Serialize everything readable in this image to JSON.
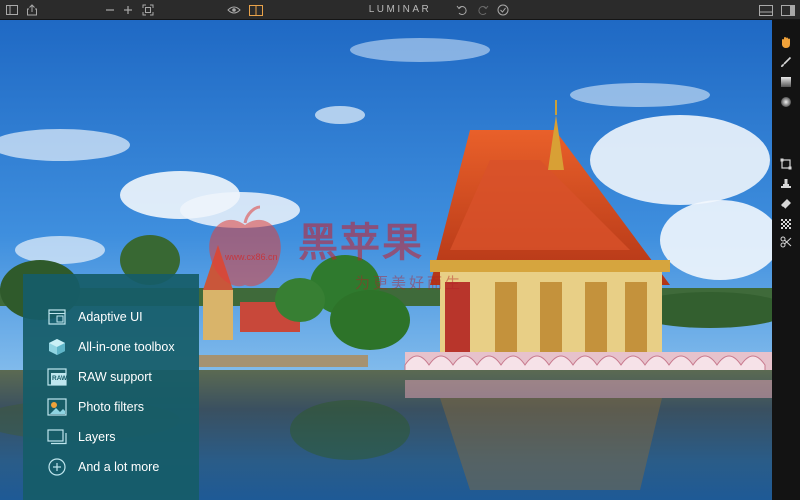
{
  "app": {
    "title": "LUMINAR"
  },
  "toolbar": {
    "left": [
      {
        "name": "sidebar-toggle-icon"
      },
      {
        "name": "share-icon"
      },
      {
        "name": "zoom-out-icon"
      },
      {
        "name": "zoom-in-icon"
      },
      {
        "name": "fit-screen-icon"
      }
    ],
    "center": [
      {
        "name": "preview-eye-icon"
      },
      {
        "name": "compare-split-icon"
      },
      {
        "name": "undo-icon"
      },
      {
        "name": "redo-icon"
      },
      {
        "name": "history-icon"
      }
    ],
    "right": [
      {
        "name": "layout-icon"
      },
      {
        "name": "panel-toggle-icon"
      }
    ]
  },
  "right_tools": [
    {
      "name": "hand-tool-icon"
    },
    {
      "name": "brush-tool-icon"
    },
    {
      "name": "gradient-tool-icon"
    },
    {
      "name": "radial-tool-icon"
    },
    {
      "name": "crop-tool-icon"
    },
    {
      "name": "clone-stamp-icon"
    },
    {
      "name": "eraser-icon"
    },
    {
      "name": "noise-tool-icon"
    },
    {
      "name": "transform-tool-icon"
    }
  ],
  "features": [
    {
      "label": "Adaptive UI",
      "icon": "adaptive-ui-icon"
    },
    {
      "label": "All-in-one toolbox",
      "icon": "toolbox-cube-icon"
    },
    {
      "label": "RAW support",
      "icon": "raw-icon",
      "icon_text": "RAW"
    },
    {
      "label": "Photo filters",
      "icon": "photo-filters-icon"
    },
    {
      "label": "Layers",
      "icon": "layers-icon"
    },
    {
      "label": "And a lot more",
      "icon": "plus-circle-icon"
    }
  ],
  "watermark": {
    "brand": "黑苹果",
    "url": "www.cx86.cn",
    "slogan": "为更美好而生"
  },
  "colors": {
    "panel": "#165c68",
    "toolbar": "#2b2b2b",
    "active_tool": "#f0a23a",
    "compare_active": "#e8a24a"
  }
}
